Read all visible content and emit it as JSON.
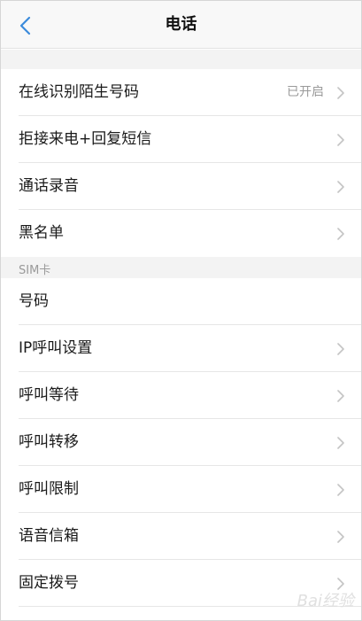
{
  "header": {
    "title": "电话",
    "back_icon": "chevron-left-icon",
    "accent_color": "#3b8bdb"
  },
  "sections": {
    "sim_label": "SIM卡"
  },
  "rows": [
    {
      "label": "在线识别陌生号码",
      "value": "已开启"
    },
    {
      "label": "拒接来电+回复短信"
    },
    {
      "label": "通话录音"
    },
    {
      "label": "黑名单"
    },
    {
      "label": "号码"
    },
    {
      "label": "IP呼叫设置"
    },
    {
      "label": "呼叫等待"
    },
    {
      "label": "呼叫转移"
    },
    {
      "label": "呼叫限制"
    },
    {
      "label": "语音信箱"
    },
    {
      "label": "固定拨号"
    }
  ],
  "watermark": "Bai经验"
}
